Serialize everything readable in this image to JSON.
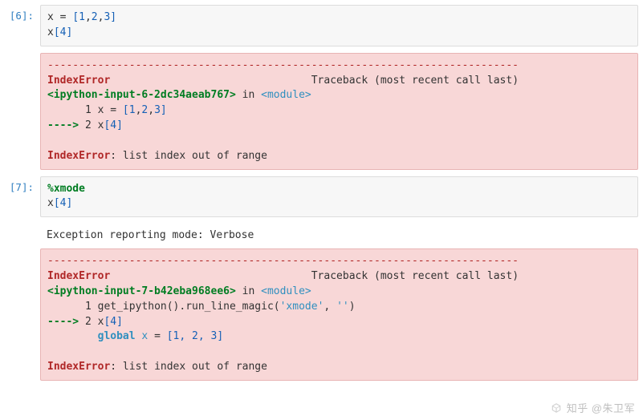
{
  "cells": [
    {
      "prompt": "[6]:",
      "input": {
        "line1_var": "x",
        "line1_eq": " = ",
        "line1_list_open": "[",
        "line1_v1": "1",
        "line1_c1": ",",
        "line1_v2": "2",
        "line1_c2": ",",
        "line1_v3": "3",
        "line1_list_close": "]",
        "line2_var": "x",
        "line2_open": "[",
        "line2_idx": "4",
        "line2_close": "]"
      },
      "error": {
        "sep": "---------------------------------------------------------------------------",
        "name": "IndexError",
        "trace_label": "Traceback (most recent call last)",
        "file": "<ipython-input-6-2dc34aeab767>",
        "in_word": " in ",
        "module": "<module>",
        "l1_num": "1",
        "l1_txt_a": " x ",
        "l1_txt_b": "=",
        "l1_txt_c": " [",
        "l1_txt_d": "1",
        "l1_txt_e": ",",
        "l1_txt_f": "2",
        "l1_txt_g": ",",
        "l1_txt_h": "3",
        "l1_txt_i": "]",
        "arrow": "----> ",
        "l2_num": "2",
        "l2_txt_a": " x",
        "l2_txt_b": "[",
        "l2_txt_c": "4",
        "l2_txt_d": "]",
        "final_name": "IndexError",
        "final_msg": ": list index out of range"
      }
    },
    {
      "prompt": "[7]:",
      "input": {
        "magic": "%xmode",
        "line2_var": "x",
        "line2_open": "[",
        "line2_idx": "4",
        "line2_close": "]"
      },
      "plain": "Exception reporting mode: Verbose",
      "error": {
        "sep": "---------------------------------------------------------------------------",
        "name": "IndexError",
        "trace_label": "Traceback (most recent call last)",
        "file": "<ipython-input-7-b42eba968ee6>",
        "in_word": " in ",
        "module": "<module>",
        "l1_num": "1",
        "l1_txt_a": " get_ipython().run_line_magic(",
        "l1_txt_b": "'xmode'",
        "l1_txt_c": ", ",
        "l1_txt_d": "''",
        "l1_txt_e": ")",
        "arrow": "----> ",
        "l2_num": "2",
        "l2_txt_a": " x",
        "l2_txt_b": "[",
        "l2_txt_c": "4",
        "l2_txt_d": "]",
        "global_kw": "global",
        "global_var": " x ",
        "global_eq": "= ",
        "global_val": "[1, 2, 3]",
        "final_name": "IndexError",
        "final_msg": ": list index out of range"
      }
    }
  ],
  "watermark": "知乎 @朱卫军"
}
